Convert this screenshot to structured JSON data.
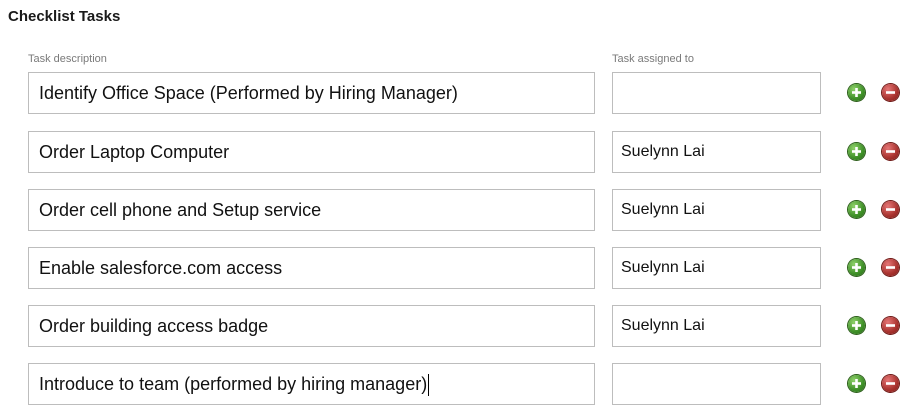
{
  "section": {
    "title": "Checklist Tasks"
  },
  "columns": {
    "description": "Task description",
    "assigned_to": "Task assigned to"
  },
  "tasks": [
    {
      "description": "Identify Office Space (Performed by Hiring Manager)",
      "assigned_to": ""
    },
    {
      "description": "Order Laptop Computer",
      "assigned_to": "Suelynn Lai"
    },
    {
      "description": "Order cell phone and Setup service",
      "assigned_to": "Suelynn Lai"
    },
    {
      "description": "Enable salesforce.com access",
      "assigned_to": "Suelynn Lai"
    },
    {
      "description": "Order building access badge",
      "assigned_to": "Suelynn Lai"
    },
    {
      "description": "Introduce to team (performed by hiring manager)",
      "assigned_to": ""
    }
  ],
  "icons": {
    "add": "add-circle-icon",
    "remove": "remove-circle-icon"
  },
  "colors": {
    "add": "#3e8f27",
    "remove": "#a8322e"
  }
}
